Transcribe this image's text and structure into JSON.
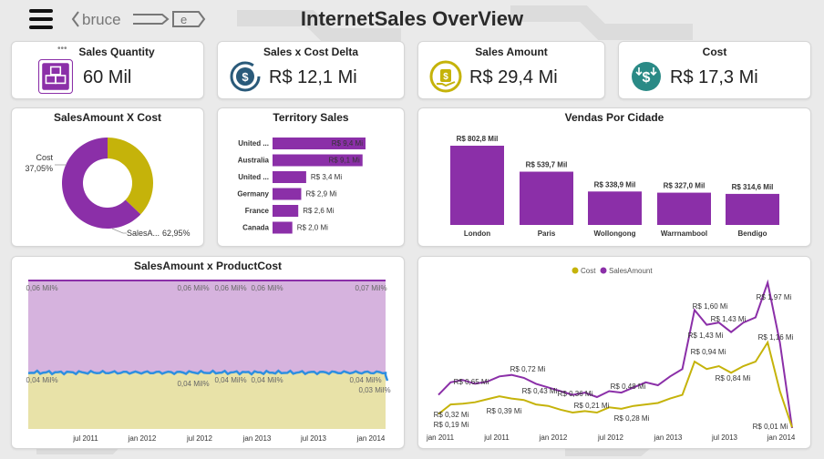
{
  "header": {
    "title": "InternetSales OverView",
    "logo_text": "bruce",
    "menu_icon": "hamburger-icon"
  },
  "colors": {
    "purple": "#8b2fa8",
    "gold": "#c5b30a",
    "teal": "#2a8a86",
    "navy": "#2a5a7a"
  },
  "kpis": [
    {
      "title": "Sales Quantity",
      "value": "60 Mil",
      "icon": "boxes-icon"
    },
    {
      "title": "Sales x Cost Delta",
      "value": "R$ 12,1 Mi",
      "icon": "dollar-cycle-icon"
    },
    {
      "title": "Sales Amount",
      "value": "R$ 29,4 Mi",
      "icon": "money-hand-icon"
    },
    {
      "title": "Cost",
      "value": "R$ 17,3 Mi",
      "icon": "dollar-down-icon"
    }
  ],
  "more_options_label": "•••",
  "chart_data": [
    {
      "type": "pie",
      "title": "SalesAmount X Cost",
      "slices": [
        {
          "label": "Cost",
          "value": 37.05,
          "display": "37,05%",
          "color": "#c5b30a"
        },
        {
          "label": "SalesA...",
          "value": 62.95,
          "display": "62,95%",
          "color": "#8b2fa8"
        }
      ]
    },
    {
      "type": "bar",
      "title": "Territory Sales",
      "orientation": "horizontal",
      "categories": [
        "United ...",
        "Australia",
        "United ...",
        "Germany",
        "France",
        "Canada"
      ],
      "values": [
        9.4,
        9.1,
        3.4,
        2.9,
        2.6,
        2.0
      ],
      "labels": [
        "R$ 9,4 Mi",
        "R$ 9,1 Mi",
        "R$ 3,4 Mi",
        "R$ 2,9 Mi",
        "R$ 2,6 Mi",
        "R$ 2,0 Mi"
      ]
    },
    {
      "type": "bar",
      "title": "Vendas Por Cidade",
      "categories": [
        "London",
        "Paris",
        "Wollongong",
        "Warrnambool",
        "Bendigo"
      ],
      "values": [
        802.8,
        539.7,
        338.9,
        327.0,
        314.6
      ],
      "labels": [
        "R$ 802,8 Mil",
        "R$ 539,7 Mil",
        "R$ 338,9 Mil",
        "R$ 327,0 Mil",
        "R$ 314,6 Mil"
      ]
    },
    {
      "type": "area",
      "title": "SalesAmount x ProductCost",
      "x_ticks": [
        "jul 2011",
        "jan 2012",
        "jul 2012",
        "jan 2013",
        "jul 2013",
        "jan 2014"
      ],
      "top_labels": [
        "0,06 Mil%",
        "0,06 Mil%",
        "0,06 Mil%",
        "0,06 Mil%",
        "0,07 Mil%"
      ],
      "bottom_labels": [
        "0,04 Mil%",
        "0,04 Mil%",
        "0,04 Mil%",
        "0,04 Mil%",
        "0,04 Mil%",
        "0,03 Mil%"
      ]
    },
    {
      "type": "line",
      "legend": [
        "Cost",
        "SalesAmount"
      ],
      "x_ticks": [
        "jan 2011",
        "jul 2011",
        "jan 2012",
        "jul 2012",
        "jan 2013",
        "jul 2013",
        "jan 2014"
      ],
      "sales_labels": [
        "R$ 0,65 Mi",
        "R$ 0,72 Mi",
        "R$ 0,36 Mi",
        "R$ 0,48 Mi",
        "R$ 1,60 Mi",
        "R$ 1,43 Mi",
        "R$ 1,43 Mi",
        "R$ 0,94 Mi",
        "R$ 1,97 Mi",
        "R$ 1,16 Mi"
      ],
      "cost_labels": [
        "R$ 0,32 Mi",
        "R$ 0,19 Mi",
        "R$ 0,39 Mi",
        "R$ 0,43 Mi",
        "R$ 0,21 Mi",
        "R$ 0,28 Mi",
        "R$ 0,84 Mi",
        "R$ 0,01 Mi"
      ],
      "series": [
        {
          "name": "SalesAmount",
          "color": "#8b2fa8",
          "values": [
            0.45,
            0.62,
            0.65,
            0.6,
            0.63,
            0.7,
            0.72,
            0.68,
            0.6,
            0.55,
            0.5,
            0.45,
            0.48,
            0.42,
            0.5,
            0.48,
            0.55,
            0.62,
            0.58,
            0.7,
            0.8,
            1.6,
            1.4,
            1.43,
            1.3,
            1.43,
            1.5,
            1.97,
            1.16,
            0.0
          ]
        },
        {
          "name": "Cost",
          "color": "#c5b30a",
          "values": [
            0.19,
            0.32,
            0.33,
            0.35,
            0.39,
            0.43,
            0.4,
            0.38,
            0.32,
            0.3,
            0.25,
            0.21,
            0.23,
            0.21,
            0.28,
            0.26,
            0.3,
            0.32,
            0.34,
            0.4,
            0.45,
            0.9,
            0.8,
            0.84,
            0.75,
            0.84,
            0.9,
            1.16,
            0.5,
            0.01
          ]
        }
      ]
    }
  ]
}
